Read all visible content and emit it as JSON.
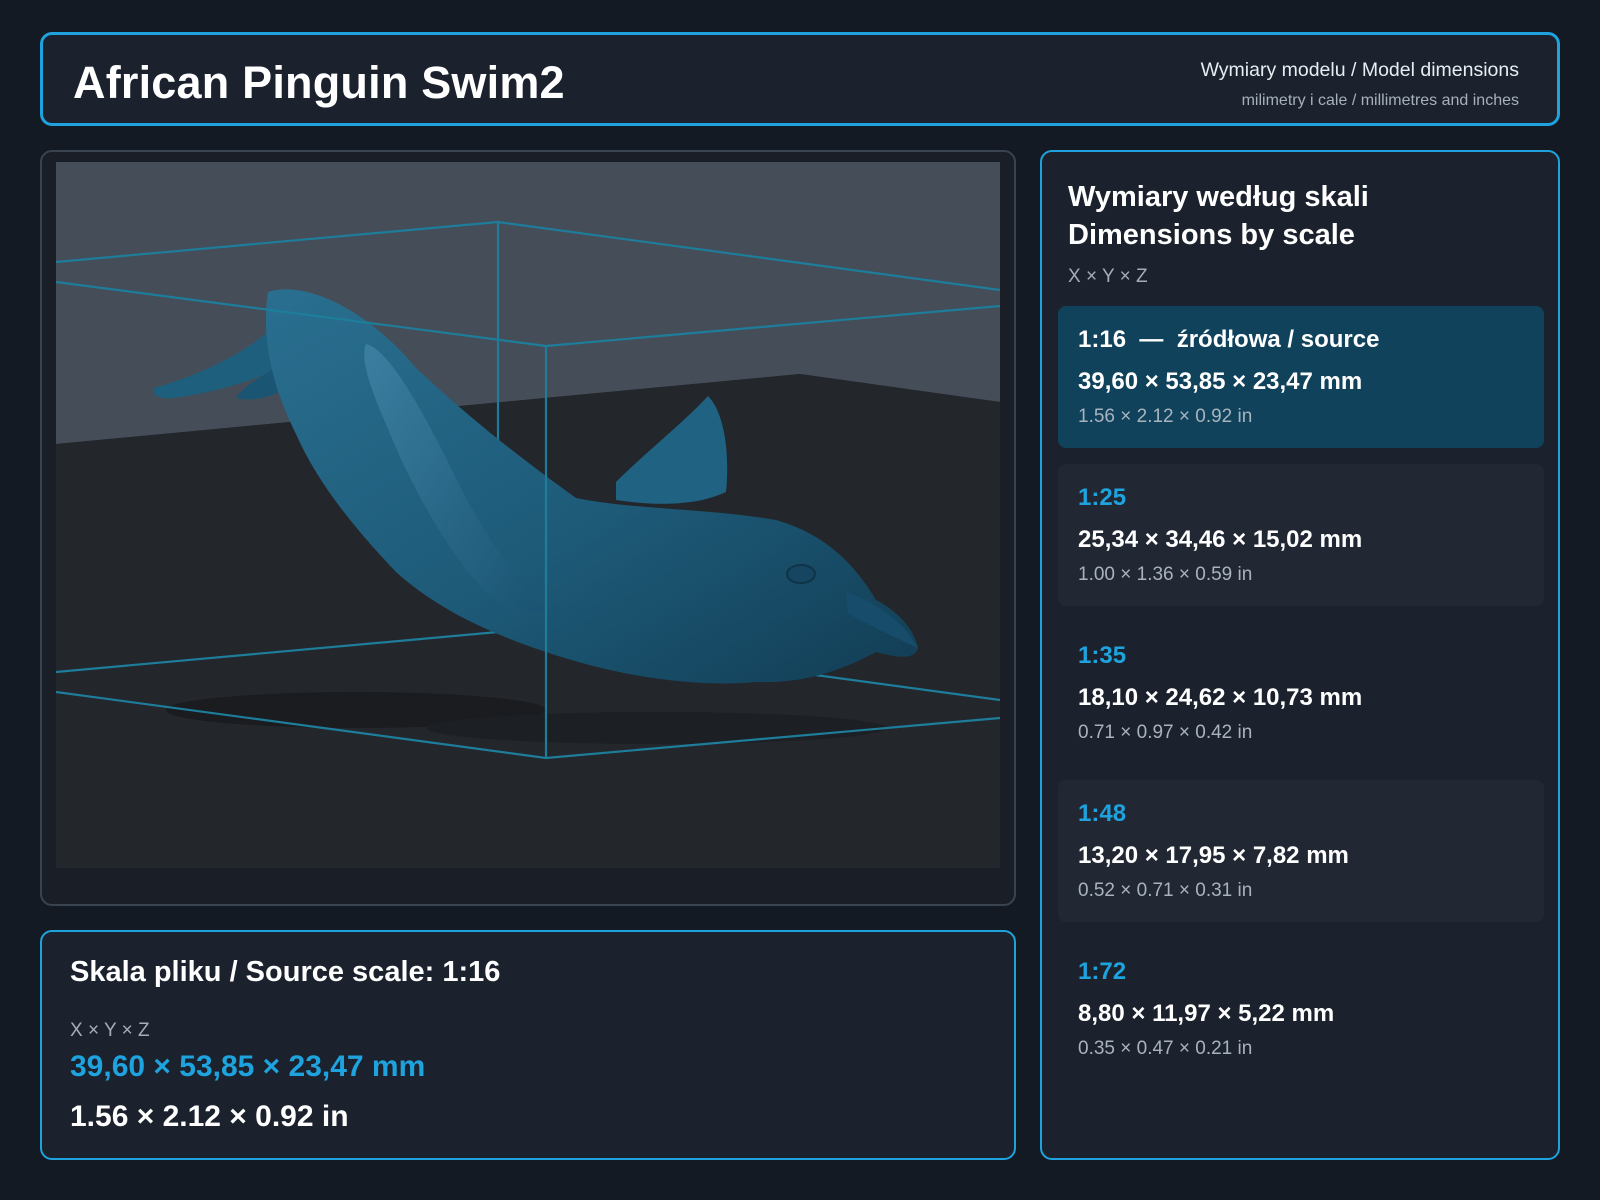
{
  "header": {
    "title": "African Pinguin Swim2",
    "subtitle_line1": "Wymiary modelu / Model dimensions",
    "subtitle_line2": "milimetry i cale / millimetres and inches"
  },
  "source": {
    "title": "Skala pliku / Source scale: 1:16",
    "axes": "X × Y × Z",
    "mm": "39,60 × 53,85 × 23,47 mm",
    "in": "1.56 × 2.12 × 0.92 in"
  },
  "scales": {
    "title_line1": "Wymiary według skali",
    "title_line2": "Dimensions by scale",
    "axes": "X × Y × Z",
    "items": [
      {
        "label": "1:16  —  źródłowa / source",
        "mm": "39,60 × 53,85 × 23,47 mm",
        "in": "1.56 × 2.12 × 0.92 in"
      },
      {
        "label": "1:25",
        "mm": "25,34 × 34,46 × 15,02 mm",
        "in": "1.00 × 1.36 × 0.59 in"
      },
      {
        "label": "1:35",
        "mm": "18,10 × 24,62 × 10,73 mm",
        "in": "0.71 × 0.97 × 0.42 in"
      },
      {
        "label": "1:48",
        "mm": "13,20 × 17,95 × 7,82 mm",
        "in": "0.52 × 0.71 × 0.31 in"
      },
      {
        "label": "1:72",
        "mm": "8,80 × 11,97 × 5,22 mm",
        "in": "0.35 × 0.47 × 0.21 in"
      }
    ]
  },
  "colors": {
    "accent": "#1ea3de",
    "background": "#131a24",
    "panel": "#1b222d",
    "active_item": "#10425c",
    "model": "#1d5a78"
  }
}
